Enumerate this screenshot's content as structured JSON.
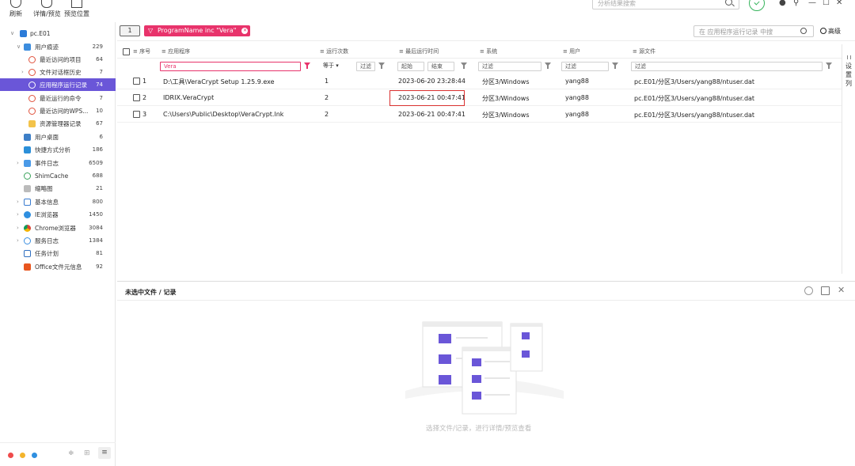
{
  "toolbar": {
    "buttons": [
      {
        "label": "刷新"
      },
      {
        "label": "详情/预览"
      },
      {
        "label": "预览位置"
      }
    ],
    "search_placeholder": "分析结果搜索"
  },
  "sidebar": {
    "root": "pc.E01",
    "items": [
      {
        "label": "用户痕迹",
        "count": "229"
      },
      {
        "label": "最近访问的项目",
        "count": "64"
      },
      {
        "label": "文件对话框历史",
        "count": "7"
      },
      {
        "label": "应用程序运行记录",
        "count": "74"
      },
      {
        "label": "最近运行的命令",
        "count": "7"
      },
      {
        "label": "最近访问的WPS...",
        "count": "10"
      },
      {
        "label": "资源管理器记录",
        "count": "67"
      },
      {
        "label": "用户桌面",
        "count": "6"
      },
      {
        "label": "快捷方式分析",
        "count": "186"
      },
      {
        "label": "事件日志",
        "count": "6509"
      },
      {
        "label": "ShimCache",
        "count": "688"
      },
      {
        "label": "缩略图",
        "count": "21"
      },
      {
        "label": "基本信息",
        "count": "800"
      },
      {
        "label": "IE浏览器",
        "count": "1450"
      },
      {
        "label": "Chrome浏览器",
        "count": "3084"
      },
      {
        "label": "服务日志",
        "count": "1384"
      },
      {
        "label": "任务计划",
        "count": "81"
      },
      {
        "label": "Office文件元信息",
        "count": "92"
      }
    ]
  },
  "filterbar": {
    "count_box": "1",
    "chip_label": "ProgramName inc \"Vera\"",
    "search_placeholder": "在 应用程序运行记录 中搜",
    "advanced_label": "高级"
  },
  "table": {
    "columns": [
      "序号",
      "应用程序",
      "运行次数",
      "最后运行时间",
      "系统",
      "用户",
      "源文件"
    ],
    "filters": {
      "app": "Vera",
      "count_op": "等于",
      "count_val": "过滤",
      "time_start": "起始",
      "time_end": "结束",
      "system": "过滤",
      "user": "过滤",
      "source": "过滤"
    },
    "rows": [
      {
        "idx": "1",
        "app": "D:\\工具\\VeraCrypt Setup 1.25.9.exe",
        "count": "1",
        "time": "2023-06-20 23:28:44",
        "system": "分区3/Windows",
        "user": "yang88",
        "source": "pc.E01/分区3/Users/yang88/ntuser.dat"
      },
      {
        "idx": "2",
        "app": "IDRIX.VeraCrypt",
        "count": "2",
        "time": "2023-06-21 00:47:41",
        "system": "分区3/Windows",
        "user": "yang88",
        "source": "pc.E01/分区3/Users/yang88/ntuser.dat"
      },
      {
        "idx": "3",
        "app": "C:\\Users\\Public\\Desktop\\VeraCrypt.lnk",
        "count": "2",
        "time": "2023-06-21 00:47:41",
        "system": "分区3/Windows",
        "user": "yang88",
        "source": "pc.E01/分区3/Users/yang88/ntuser.dat"
      }
    ]
  },
  "right_panel": {
    "label": "设置列"
  },
  "detail": {
    "title": "未选中文件 / 记录",
    "empty_text": "选择文件/记录，进行详情/预览查看"
  },
  "colors": {
    "accent": "#6a56d8",
    "chip": "#e8336b",
    "highlight": "#d9302f"
  }
}
